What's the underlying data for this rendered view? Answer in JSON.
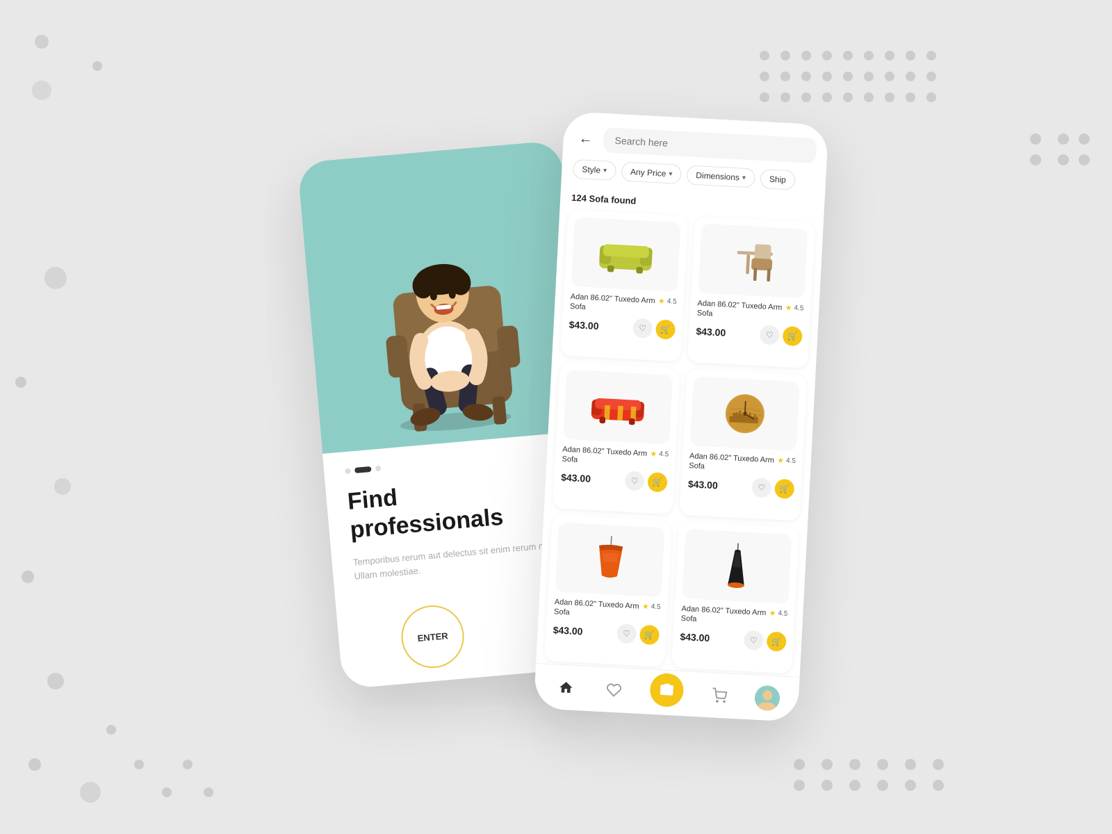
{
  "background": {
    "color": "#e8e8e8"
  },
  "left_phone": {
    "heading_line1": "Find",
    "heading_line2": "professionals",
    "description": "Temporibus rerum aut delectus sit enim rerum nostrum Ullam molestiae.",
    "enter_label": "ENTER",
    "hero_bg_color": "#8ecdc5"
  },
  "right_phone": {
    "search_placeholder": "Search here",
    "back_label": "←",
    "filters": [
      {
        "label": "Style",
        "has_arrow": true
      },
      {
        "label": "Any Price",
        "has_arrow": true
      },
      {
        "label": "Dimensions",
        "has_arrow": true
      },
      {
        "label": "Ship",
        "has_arrow": false
      }
    ],
    "results_count": "124 Sofa found",
    "products": [
      {
        "name": "Adan 86.02\" Tuxedo Arm Sofa",
        "rating": "4.5",
        "price": "$43.00",
        "type": "sofa-green"
      },
      {
        "name": "Adan 86.02\" Tuxedo Arm Sofa",
        "rating": "4.5",
        "price": "$43.00",
        "type": "sofa-brown"
      },
      {
        "name": "Adan 86.02\" Tuxedo Arm Sofa",
        "rating": "4.5",
        "price": "$43.00",
        "type": "sofa-red"
      },
      {
        "name": "Adan 86.02\" Tuxedo Arm Sofa",
        "rating": "4.5",
        "price": "$43.00",
        "type": "clock"
      },
      {
        "name": "Adan 86.02\" Tuxedo Arm Sofa",
        "rating": "4.5",
        "price": "$43.00",
        "type": "lamp-orange"
      },
      {
        "name": "Adan 86.02\" Tuxedo Arm Sofa",
        "rating": "4.5",
        "price": "$43.00",
        "type": "lamp-black"
      }
    ],
    "nav": {
      "home": "🏠",
      "heart": "♡",
      "camera": "◎",
      "cart": "🛒"
    }
  }
}
